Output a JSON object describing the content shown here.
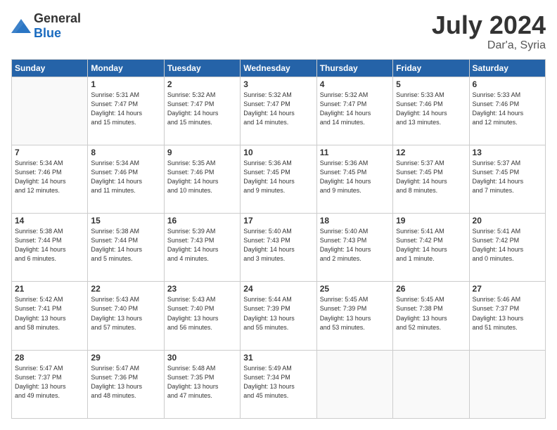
{
  "header": {
    "logo_general": "General",
    "logo_blue": "Blue",
    "title": "July 2024",
    "subtitle": "Dar'a, Syria"
  },
  "days_of_week": [
    "Sunday",
    "Monday",
    "Tuesday",
    "Wednesday",
    "Thursday",
    "Friday",
    "Saturday"
  ],
  "weeks": [
    [
      {
        "day": "",
        "info": ""
      },
      {
        "day": "1",
        "info": "Sunrise: 5:31 AM\nSunset: 7:47 PM\nDaylight: 14 hours\nand 15 minutes."
      },
      {
        "day": "2",
        "info": "Sunrise: 5:32 AM\nSunset: 7:47 PM\nDaylight: 14 hours\nand 15 minutes."
      },
      {
        "day": "3",
        "info": "Sunrise: 5:32 AM\nSunset: 7:47 PM\nDaylight: 14 hours\nand 14 minutes."
      },
      {
        "day": "4",
        "info": "Sunrise: 5:32 AM\nSunset: 7:47 PM\nDaylight: 14 hours\nand 14 minutes."
      },
      {
        "day": "5",
        "info": "Sunrise: 5:33 AM\nSunset: 7:46 PM\nDaylight: 14 hours\nand 13 minutes."
      },
      {
        "day": "6",
        "info": "Sunrise: 5:33 AM\nSunset: 7:46 PM\nDaylight: 14 hours\nand 12 minutes."
      }
    ],
    [
      {
        "day": "7",
        "info": "Sunrise: 5:34 AM\nSunset: 7:46 PM\nDaylight: 14 hours\nand 12 minutes."
      },
      {
        "day": "8",
        "info": "Sunrise: 5:34 AM\nSunset: 7:46 PM\nDaylight: 14 hours\nand 11 minutes."
      },
      {
        "day": "9",
        "info": "Sunrise: 5:35 AM\nSunset: 7:46 PM\nDaylight: 14 hours\nand 10 minutes."
      },
      {
        "day": "10",
        "info": "Sunrise: 5:36 AM\nSunset: 7:45 PM\nDaylight: 14 hours\nand 9 minutes."
      },
      {
        "day": "11",
        "info": "Sunrise: 5:36 AM\nSunset: 7:45 PM\nDaylight: 14 hours\nand 9 minutes."
      },
      {
        "day": "12",
        "info": "Sunrise: 5:37 AM\nSunset: 7:45 PM\nDaylight: 14 hours\nand 8 minutes."
      },
      {
        "day": "13",
        "info": "Sunrise: 5:37 AM\nSunset: 7:45 PM\nDaylight: 14 hours\nand 7 minutes."
      }
    ],
    [
      {
        "day": "14",
        "info": "Sunrise: 5:38 AM\nSunset: 7:44 PM\nDaylight: 14 hours\nand 6 minutes."
      },
      {
        "day": "15",
        "info": "Sunrise: 5:38 AM\nSunset: 7:44 PM\nDaylight: 14 hours\nand 5 minutes."
      },
      {
        "day": "16",
        "info": "Sunrise: 5:39 AM\nSunset: 7:43 PM\nDaylight: 14 hours\nand 4 minutes."
      },
      {
        "day": "17",
        "info": "Sunrise: 5:40 AM\nSunset: 7:43 PM\nDaylight: 14 hours\nand 3 minutes."
      },
      {
        "day": "18",
        "info": "Sunrise: 5:40 AM\nSunset: 7:43 PM\nDaylight: 14 hours\nand 2 minutes."
      },
      {
        "day": "19",
        "info": "Sunrise: 5:41 AM\nSunset: 7:42 PM\nDaylight: 14 hours\nand 1 minute."
      },
      {
        "day": "20",
        "info": "Sunrise: 5:41 AM\nSunset: 7:42 PM\nDaylight: 14 hours\nand 0 minutes."
      }
    ],
    [
      {
        "day": "21",
        "info": "Sunrise: 5:42 AM\nSunset: 7:41 PM\nDaylight: 13 hours\nand 58 minutes."
      },
      {
        "day": "22",
        "info": "Sunrise: 5:43 AM\nSunset: 7:40 PM\nDaylight: 13 hours\nand 57 minutes."
      },
      {
        "day": "23",
        "info": "Sunrise: 5:43 AM\nSunset: 7:40 PM\nDaylight: 13 hours\nand 56 minutes."
      },
      {
        "day": "24",
        "info": "Sunrise: 5:44 AM\nSunset: 7:39 PM\nDaylight: 13 hours\nand 55 minutes."
      },
      {
        "day": "25",
        "info": "Sunrise: 5:45 AM\nSunset: 7:39 PM\nDaylight: 13 hours\nand 53 minutes."
      },
      {
        "day": "26",
        "info": "Sunrise: 5:45 AM\nSunset: 7:38 PM\nDaylight: 13 hours\nand 52 minutes."
      },
      {
        "day": "27",
        "info": "Sunrise: 5:46 AM\nSunset: 7:37 PM\nDaylight: 13 hours\nand 51 minutes."
      }
    ],
    [
      {
        "day": "28",
        "info": "Sunrise: 5:47 AM\nSunset: 7:37 PM\nDaylight: 13 hours\nand 49 minutes."
      },
      {
        "day": "29",
        "info": "Sunrise: 5:47 AM\nSunset: 7:36 PM\nDaylight: 13 hours\nand 48 minutes."
      },
      {
        "day": "30",
        "info": "Sunrise: 5:48 AM\nSunset: 7:35 PM\nDaylight: 13 hours\nand 47 minutes."
      },
      {
        "day": "31",
        "info": "Sunrise: 5:49 AM\nSunset: 7:34 PM\nDaylight: 13 hours\nand 45 minutes."
      },
      {
        "day": "",
        "info": ""
      },
      {
        "day": "",
        "info": ""
      },
      {
        "day": "",
        "info": ""
      }
    ]
  ]
}
